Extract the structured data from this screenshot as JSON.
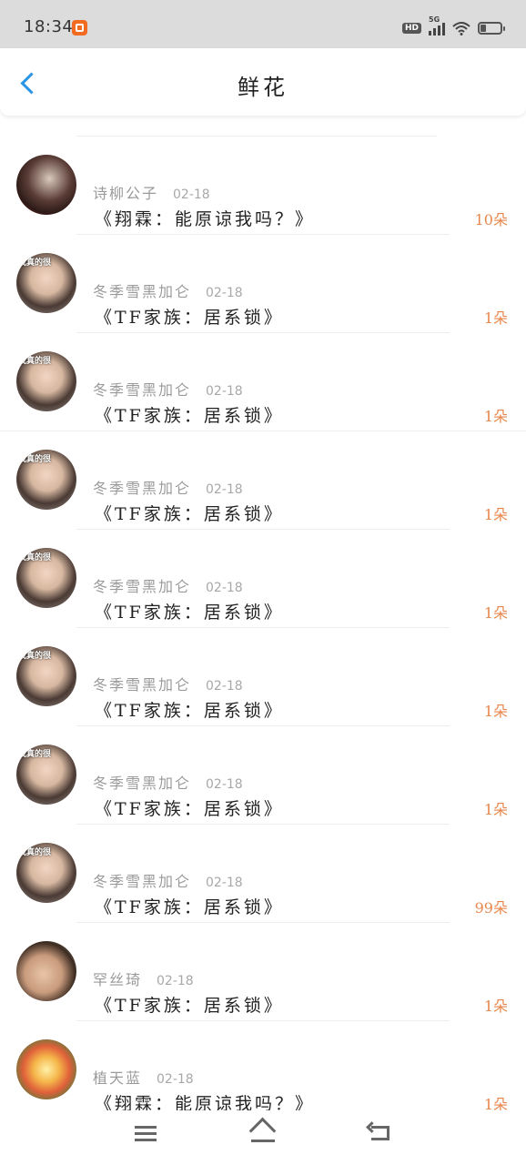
{
  "status_bar": {
    "time": "18:34",
    "hd_label": "HD",
    "network_label": "5G"
  },
  "header": {
    "title": "鲜花"
  },
  "items": [
    {
      "name": "诗柳公子",
      "date": "02-18",
      "title": "《翔霖：能原谅我吗？》",
      "count": "10朵",
      "avatar": "dark-photo"
    },
    {
      "name": "冬季雪黑加仑",
      "date": "02-18",
      "title": "《TF家族：居系锁》",
      "count": "1朵",
      "avatar": "girl-photo"
    },
    {
      "name": "冬季雪黑加仑",
      "date": "02-18",
      "title": "《TF家族：居系锁》",
      "count": "1朵",
      "avatar": "girl-photo"
    },
    {
      "name": "冬季雪黑加仑",
      "date": "02-18",
      "title": "《TF家族：居系锁》",
      "count": "1朵",
      "avatar": "girl-photo"
    },
    {
      "name": "冬季雪黑加仑",
      "date": "02-18",
      "title": "《TF家族：居系锁》",
      "count": "1朵",
      "avatar": "girl-photo"
    },
    {
      "name": "冬季雪黑加仑",
      "date": "02-18",
      "title": "《TF家族：居系锁》",
      "count": "1朵",
      "avatar": "girl-photo"
    },
    {
      "name": "冬季雪黑加仑",
      "date": "02-18",
      "title": "《TF家族：居系锁》",
      "count": "1朵",
      "avatar": "girl-photo"
    },
    {
      "name": "冬季雪黑加仑",
      "date": "02-18",
      "title": "《TF家族：居系锁》",
      "count": "99朵",
      "avatar": "girl-photo"
    },
    {
      "name": "罕丝琦",
      "date": "02-18",
      "title": "《TF家族：居系锁》",
      "count": "1朵",
      "avatar": "kid-photo"
    },
    {
      "name": "植天蓝",
      "date": "02-18",
      "title": "《翔霖：能原谅我吗？》",
      "count": "1朵",
      "avatar": "rose-photo"
    }
  ],
  "avatar_overlay_text": "我真的很",
  "icons": {
    "back": "chevron-left-icon",
    "menu": "menu-icon",
    "home": "home-icon",
    "nav_back": "back-arrow-icon"
  },
  "colors": {
    "accent": "#2a94e6",
    "count": "#e8874d",
    "name": "#9a9a9a"
  }
}
